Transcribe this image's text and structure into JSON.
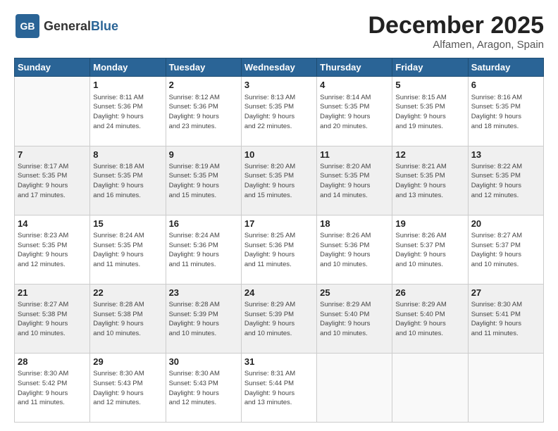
{
  "header": {
    "logo_general": "General",
    "logo_blue": "Blue",
    "month": "December 2025",
    "location": "Alfamen, Aragon, Spain"
  },
  "weekdays": [
    "Sunday",
    "Monday",
    "Tuesday",
    "Wednesday",
    "Thursday",
    "Friday",
    "Saturday"
  ],
  "weeks": [
    [
      {
        "day": "",
        "info": ""
      },
      {
        "day": "1",
        "info": "Sunrise: 8:11 AM\nSunset: 5:36 PM\nDaylight: 9 hours\nand 24 minutes."
      },
      {
        "day": "2",
        "info": "Sunrise: 8:12 AM\nSunset: 5:36 PM\nDaylight: 9 hours\nand 23 minutes."
      },
      {
        "day": "3",
        "info": "Sunrise: 8:13 AM\nSunset: 5:35 PM\nDaylight: 9 hours\nand 22 minutes."
      },
      {
        "day": "4",
        "info": "Sunrise: 8:14 AM\nSunset: 5:35 PM\nDaylight: 9 hours\nand 20 minutes."
      },
      {
        "day": "5",
        "info": "Sunrise: 8:15 AM\nSunset: 5:35 PM\nDaylight: 9 hours\nand 19 minutes."
      },
      {
        "day": "6",
        "info": "Sunrise: 8:16 AM\nSunset: 5:35 PM\nDaylight: 9 hours\nand 18 minutes."
      }
    ],
    [
      {
        "day": "7",
        "info": "Sunrise: 8:17 AM\nSunset: 5:35 PM\nDaylight: 9 hours\nand 17 minutes."
      },
      {
        "day": "8",
        "info": "Sunrise: 8:18 AM\nSunset: 5:35 PM\nDaylight: 9 hours\nand 16 minutes."
      },
      {
        "day": "9",
        "info": "Sunrise: 8:19 AM\nSunset: 5:35 PM\nDaylight: 9 hours\nand 15 minutes."
      },
      {
        "day": "10",
        "info": "Sunrise: 8:20 AM\nSunset: 5:35 PM\nDaylight: 9 hours\nand 15 minutes."
      },
      {
        "day": "11",
        "info": "Sunrise: 8:20 AM\nSunset: 5:35 PM\nDaylight: 9 hours\nand 14 minutes."
      },
      {
        "day": "12",
        "info": "Sunrise: 8:21 AM\nSunset: 5:35 PM\nDaylight: 9 hours\nand 13 minutes."
      },
      {
        "day": "13",
        "info": "Sunrise: 8:22 AM\nSunset: 5:35 PM\nDaylight: 9 hours\nand 12 minutes."
      }
    ],
    [
      {
        "day": "14",
        "info": "Sunrise: 8:23 AM\nSunset: 5:35 PM\nDaylight: 9 hours\nand 12 minutes."
      },
      {
        "day": "15",
        "info": "Sunrise: 8:24 AM\nSunset: 5:35 PM\nDaylight: 9 hours\nand 11 minutes."
      },
      {
        "day": "16",
        "info": "Sunrise: 8:24 AM\nSunset: 5:36 PM\nDaylight: 9 hours\nand 11 minutes."
      },
      {
        "day": "17",
        "info": "Sunrise: 8:25 AM\nSunset: 5:36 PM\nDaylight: 9 hours\nand 11 minutes."
      },
      {
        "day": "18",
        "info": "Sunrise: 8:26 AM\nSunset: 5:36 PM\nDaylight: 9 hours\nand 10 minutes."
      },
      {
        "day": "19",
        "info": "Sunrise: 8:26 AM\nSunset: 5:37 PM\nDaylight: 9 hours\nand 10 minutes."
      },
      {
        "day": "20",
        "info": "Sunrise: 8:27 AM\nSunset: 5:37 PM\nDaylight: 9 hours\nand 10 minutes."
      }
    ],
    [
      {
        "day": "21",
        "info": "Sunrise: 8:27 AM\nSunset: 5:38 PM\nDaylight: 9 hours\nand 10 minutes."
      },
      {
        "day": "22",
        "info": "Sunrise: 8:28 AM\nSunset: 5:38 PM\nDaylight: 9 hours\nand 10 minutes."
      },
      {
        "day": "23",
        "info": "Sunrise: 8:28 AM\nSunset: 5:39 PM\nDaylight: 9 hours\nand 10 minutes."
      },
      {
        "day": "24",
        "info": "Sunrise: 8:29 AM\nSunset: 5:39 PM\nDaylight: 9 hours\nand 10 minutes."
      },
      {
        "day": "25",
        "info": "Sunrise: 8:29 AM\nSunset: 5:40 PM\nDaylight: 9 hours\nand 10 minutes."
      },
      {
        "day": "26",
        "info": "Sunrise: 8:29 AM\nSunset: 5:40 PM\nDaylight: 9 hours\nand 10 minutes."
      },
      {
        "day": "27",
        "info": "Sunrise: 8:30 AM\nSunset: 5:41 PM\nDaylight: 9 hours\nand 11 minutes."
      }
    ],
    [
      {
        "day": "28",
        "info": "Sunrise: 8:30 AM\nSunset: 5:42 PM\nDaylight: 9 hours\nand 11 minutes."
      },
      {
        "day": "29",
        "info": "Sunrise: 8:30 AM\nSunset: 5:43 PM\nDaylight: 9 hours\nand 12 minutes."
      },
      {
        "day": "30",
        "info": "Sunrise: 8:30 AM\nSunset: 5:43 PM\nDaylight: 9 hours\nand 12 minutes."
      },
      {
        "day": "31",
        "info": "Sunrise: 8:31 AM\nSunset: 5:44 PM\nDaylight: 9 hours\nand 13 minutes."
      },
      {
        "day": "",
        "info": ""
      },
      {
        "day": "",
        "info": ""
      },
      {
        "day": "",
        "info": ""
      }
    ]
  ]
}
